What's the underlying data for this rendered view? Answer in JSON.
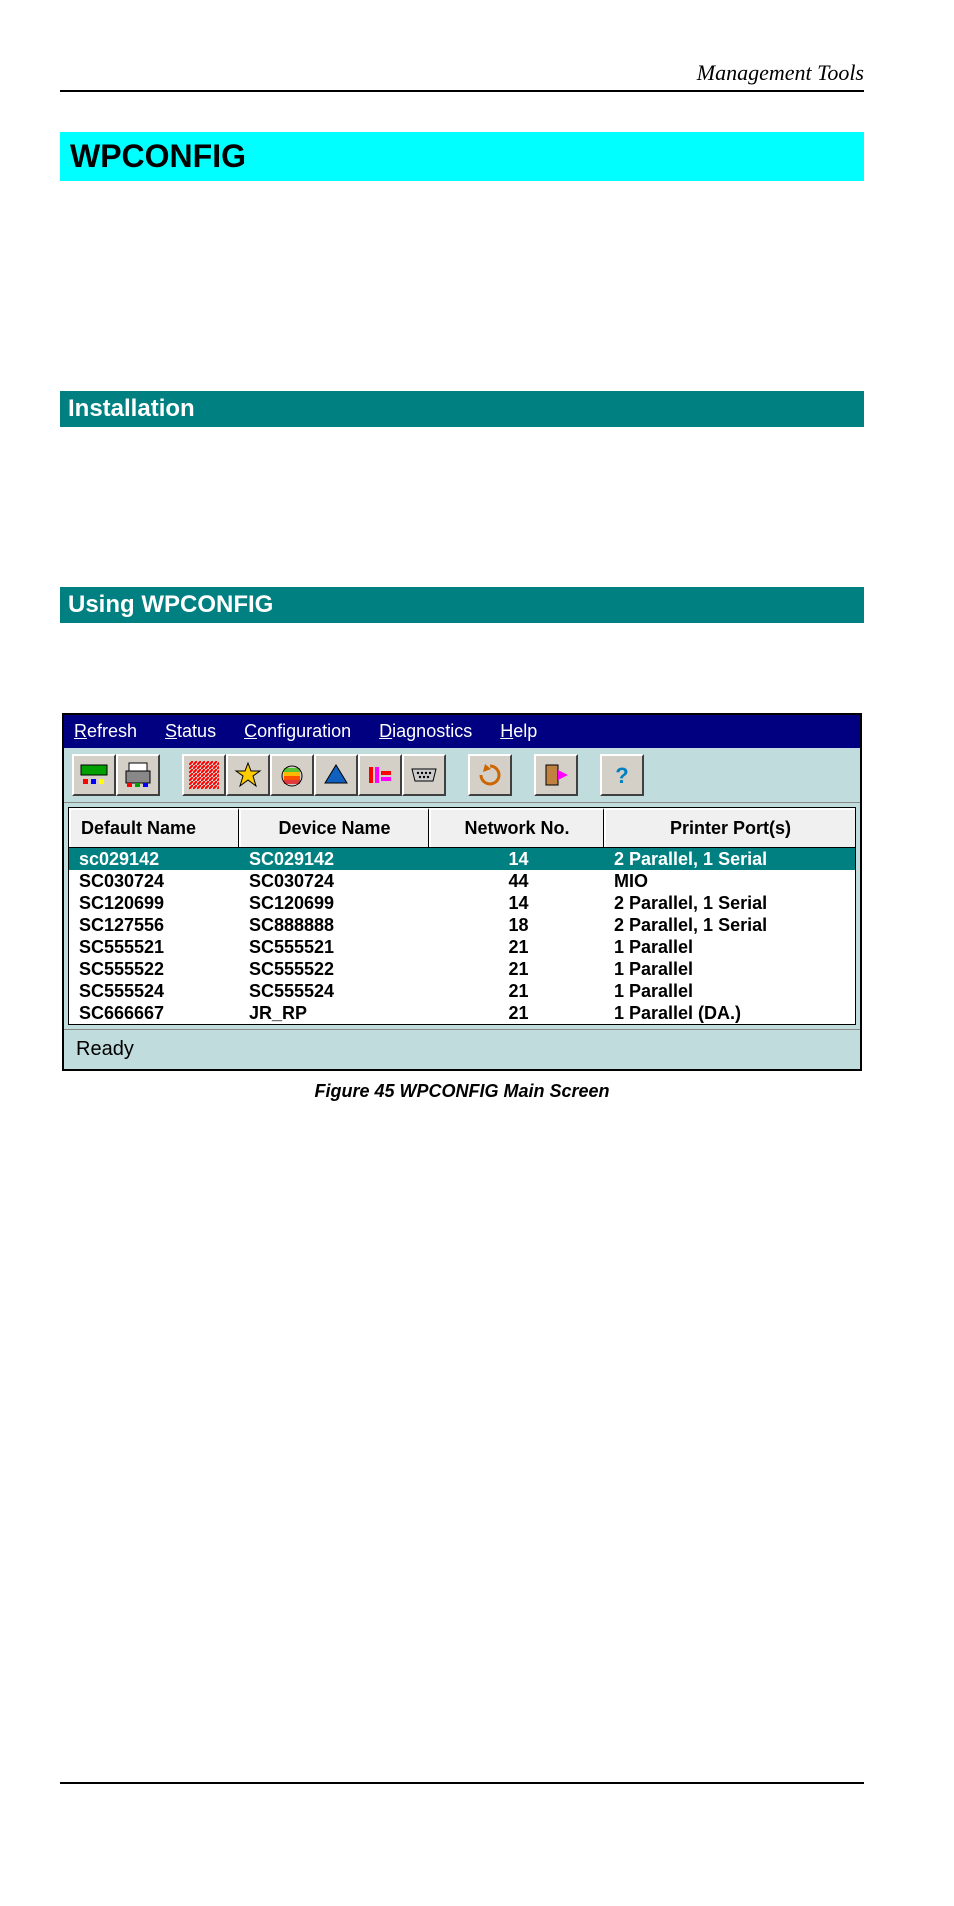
{
  "header": {
    "right": "Management Tools"
  },
  "title": "WPCONFIG",
  "sections": {
    "installation": "Installation",
    "using": "Using WPCONFIG"
  },
  "app": {
    "menu": {
      "refresh": "Refresh",
      "status": "Status",
      "configuration": "Configuration",
      "diagnostics": "Diagnostics",
      "help": "Help"
    },
    "toolbar_icons": [
      "device-icon",
      "printer-icon",
      "netware-icon",
      "burst-icon",
      "apple-icon",
      "tcpip-icon",
      "port-icon",
      "serial-icon",
      "refresh-icon",
      "exit-icon",
      "help-icon"
    ],
    "columns": {
      "default_name": "Default Name",
      "device_name": "Device Name",
      "network_no": "Network No.",
      "printer_ports": "Printer Port(s)"
    },
    "rows": [
      {
        "default_name": "sc029142",
        "device_name": "SC029142",
        "network_no": "14",
        "ports": "2 Parallel, 1 Serial",
        "selected": true
      },
      {
        "default_name": "SC030724",
        "device_name": "SC030724",
        "network_no": "44",
        "ports": "MIO"
      },
      {
        "default_name": "SC120699",
        "device_name": "SC120699",
        "network_no": "14",
        "ports": "2 Parallel, 1 Serial"
      },
      {
        "default_name": "SC127556",
        "device_name": "SC888888",
        "network_no": "18",
        "ports": "2 Parallel, 1 Serial"
      },
      {
        "default_name": "SC555521",
        "device_name": "SC555521",
        "network_no": "21",
        "ports": "1 Parallel"
      },
      {
        "default_name": "SC555522",
        "device_name": "SC555522",
        "network_no": "21",
        "ports": "1 Parallel"
      },
      {
        "default_name": "SC555524",
        "device_name": "SC555524",
        "network_no": "21",
        "ports": "1 Parallel"
      },
      {
        "default_name": "SC666667",
        "device_name": "JR_RP",
        "network_no": "21",
        "ports": "1 Parallel (DA.)"
      }
    ],
    "status": "Ready"
  },
  "caption": "Figure 45 WPCONFIG Main Screen"
}
